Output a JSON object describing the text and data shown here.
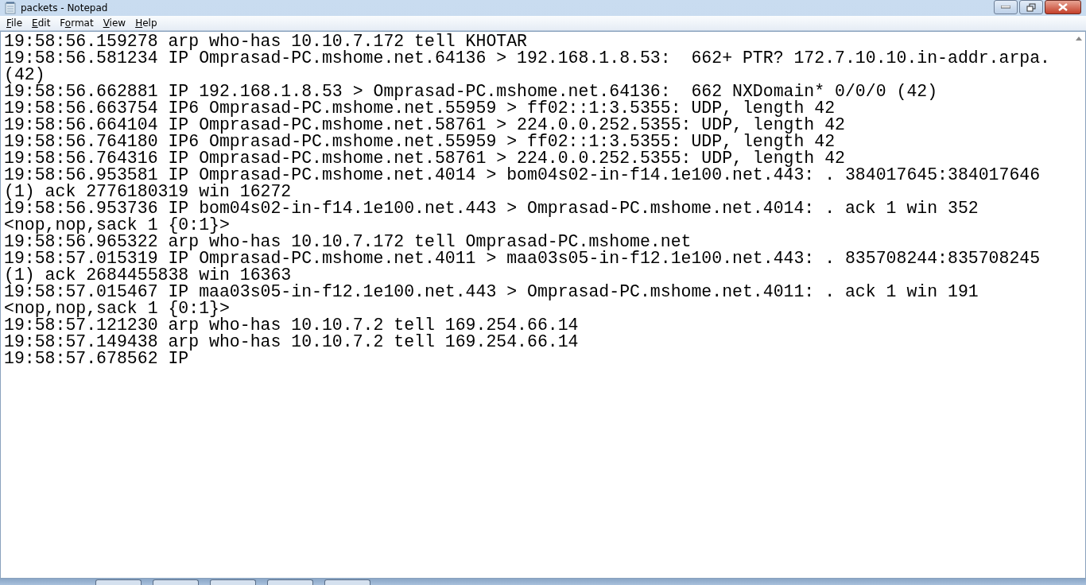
{
  "window": {
    "title": "packets - Notepad"
  },
  "menu": [
    {
      "accel": "F",
      "post": "ile"
    },
    {
      "accel": "E",
      "post": "dit"
    },
    {
      "pre": "F",
      "accel": "o",
      "post": "rmat"
    },
    {
      "accel": "V",
      "post": "iew"
    },
    {
      "accel": "H",
      "post": "elp"
    }
  ],
  "lines": [
    "19:58:56.159278 arp who-has 10.10.7.172 tell KHOTAR",
    "19:58:56.581234 IP Omprasad-PC.mshome.net.64136 > 192.168.1.8.53:  662+ PTR? 172.7.10.10.in-addr.arpa.",
    "(42)",
    "19:58:56.662881 IP 192.168.1.8.53 > Omprasad-PC.mshome.net.64136:  662 NXDomain* 0/0/0 (42)",
    "19:58:56.663754 IP6 Omprasad-PC.mshome.net.55959 > ff02::1:3.5355: UDP, length 42",
    "19:58:56.664104 IP Omprasad-PC.mshome.net.58761 > 224.0.0.252.5355: UDP, length 42",
    "19:58:56.764180 IP6 Omprasad-PC.mshome.net.55959 > ff02::1:3.5355: UDP, length 42",
    "19:58:56.764316 IP Omprasad-PC.mshome.net.58761 > 224.0.0.252.5355: UDP, length 42",
    "19:58:56.953581 IP Omprasad-PC.mshome.net.4014 > bom04s02-in-f14.1e100.net.443: . 384017645:384017646",
    "(1) ack 2776180319 win 16272",
    "19:58:56.953736 IP bom04s02-in-f14.1e100.net.443 > Omprasad-PC.mshome.net.4014: . ack 1 win 352",
    "<nop,nop,sack 1 {0:1}>",
    "19:58:56.965322 arp who-has 10.10.7.172 tell Omprasad-PC.mshome.net",
    "19:58:57.015319 IP Omprasad-PC.mshome.net.4011 > maa03s05-in-f12.1e100.net.443: . 835708244:835708245",
    "(1) ack 2684455838 win 16363",
    "19:58:57.015467 IP maa03s05-in-f12.1e100.net.443 > Omprasad-PC.mshome.net.4011: . ack 1 win 191",
    "<nop,nop,sack 1 {0:1}>",
    "19:58:57.121230 arp who-has 10.10.7.2 tell 169.254.66.14",
    "19:58:57.149438 arp who-has 10.10.7.2 tell 169.254.66.14",
    "19:58:57.678562 IP"
  ]
}
